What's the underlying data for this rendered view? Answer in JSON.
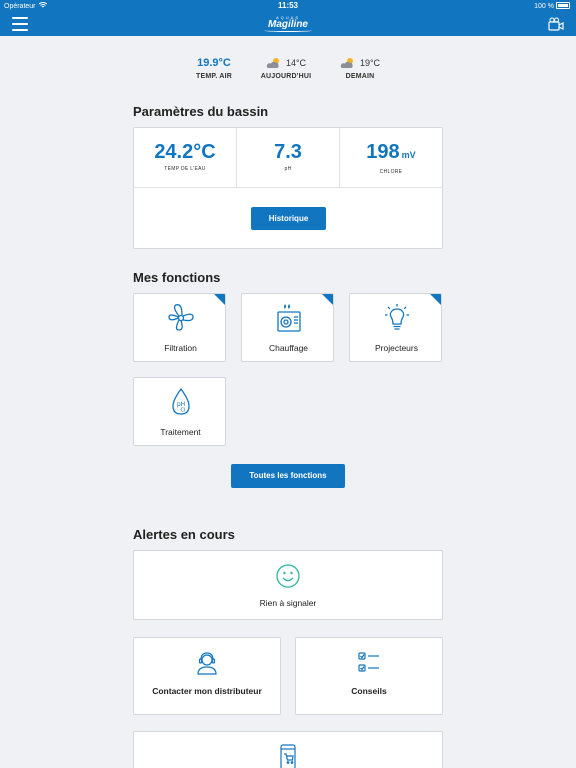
{
  "status_bar": {
    "carrier": "Opérateur",
    "time": "11:53",
    "battery": "100 %"
  },
  "header": {
    "logo_top": "AQUAS",
    "logo_brand": "Magiline"
  },
  "weather": {
    "air": {
      "temp": "19.9°C",
      "label": "TEMP. AIR"
    },
    "today": {
      "temp": "14°C",
      "label": "AUJOURD'HUI",
      "icon": "partly-cloudy-icon"
    },
    "tomorrow": {
      "temp": "19°C",
      "label": "DEMAIN",
      "icon": "partly-cloudy-icon"
    }
  },
  "params_section": {
    "title": "Paramètres du bassin",
    "params": [
      {
        "value": "24.2°C",
        "unit": "",
        "label": "TEMP DE L'EAU"
      },
      {
        "value": "7.3",
        "unit": "",
        "label": "pH"
      },
      {
        "value": "198",
        "unit": "mV",
        "label": "CHLORE"
      }
    ],
    "history_button": "Historique"
  },
  "functions_section": {
    "title": "Mes fonctions",
    "items": [
      {
        "label": "Filtration",
        "icon": "fan-icon"
      },
      {
        "label": "Chauffage",
        "icon": "heater-icon"
      },
      {
        "label": "Projecteurs",
        "icon": "lightbulb-icon"
      },
      {
        "label": "Traitement",
        "icon": "ph-drop-icon"
      }
    ],
    "all_button": "Toutes les fonctions"
  },
  "alerts_section": {
    "title": "Alertes en cours",
    "status": "Rien à signaler",
    "status_icon": "smiley-icon",
    "contact": "Contacter mon distributeur",
    "advice": "Conseils"
  },
  "colors": {
    "accent": "#1275bf",
    "background": "#f0f1f4",
    "smiley": "#2bb5a0"
  }
}
